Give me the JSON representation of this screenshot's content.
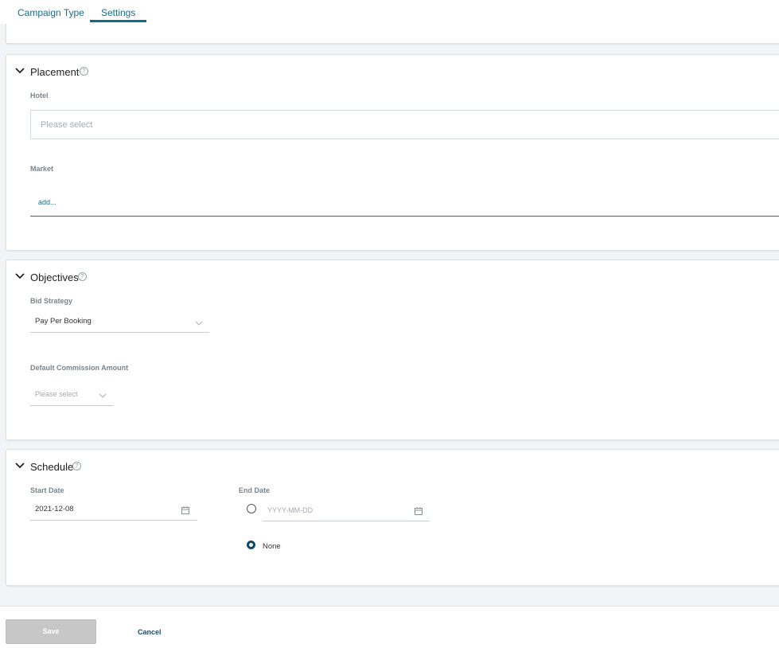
{
  "tabs": [
    {
      "label": "Campaign Type",
      "active": false
    },
    {
      "label": "Settings",
      "active": true
    }
  ],
  "placement": {
    "title": "Placement",
    "help": "?",
    "hotel_label": "Hotel",
    "hotel_placeholder": "Please select",
    "market_label": "Market",
    "market_placeholder": "add..."
  },
  "objectives": {
    "title": "Objectives",
    "help": "?",
    "bid_strategy_label": "Bid Strategy",
    "bid_strategy_value": "Pay Per Booking",
    "commission_label": "Default Commission Amount",
    "commission_placeholder": "Please select"
  },
  "schedule": {
    "title": "Schedule",
    "help": "?",
    "start_label": "Start Date",
    "start_value": "2021-12-08",
    "end_label": "End Date",
    "end_placeholder": "YYYY-MM-DD",
    "none_label": "None",
    "end_option_selected": "None"
  },
  "footer": {
    "save_label": "Save",
    "cancel_label": "Cancel"
  },
  "colors": {
    "accent": "#0e6d8c",
    "radio_selected": "#0c4a66",
    "save_disabled": "#c7c7c7"
  }
}
